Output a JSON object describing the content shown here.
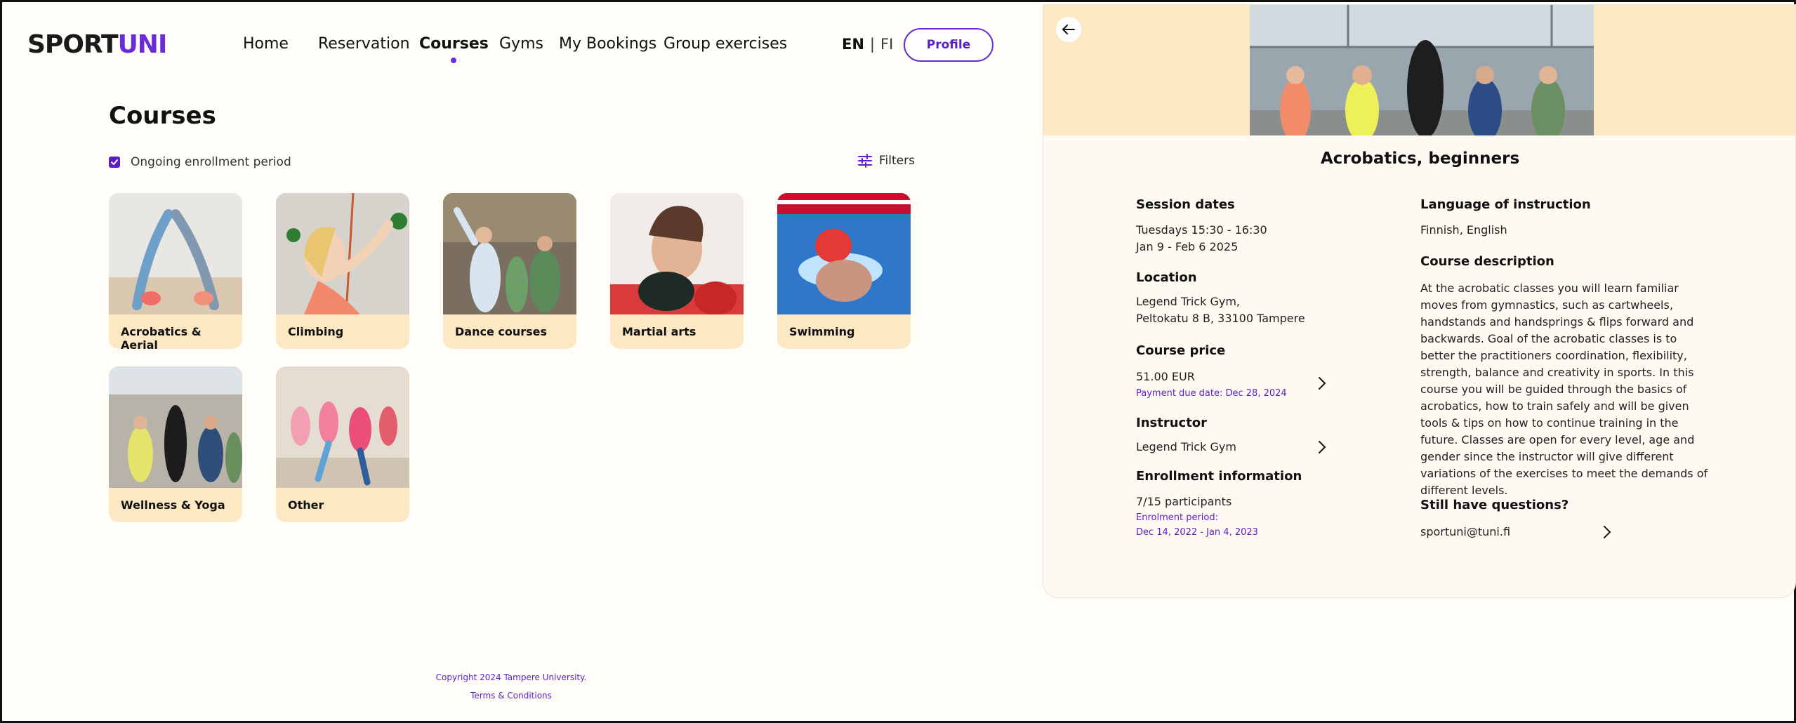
{
  "logo": {
    "sport": "SPORT",
    "uni": "UNI"
  },
  "nav": {
    "home": "Home",
    "reservation": "Reservation",
    "courses": "Courses",
    "gyms": "Gyms",
    "my_bookings": "My Bookings",
    "group_exercises": "Group exercises"
  },
  "lang": {
    "en": "EN",
    "sep": "|",
    "fi": "FI"
  },
  "profile_label": "Profile",
  "page_title": "Courses",
  "enrollment_filter_label": "Ongoing enrollment period",
  "enrollment_filter_checked": true,
  "filters_label": "Filters",
  "categories": [
    {
      "label": "Acrobatics & Aerial"
    },
    {
      "label": "Climbing"
    },
    {
      "label": "Dance courses"
    },
    {
      "label": "Martial arts"
    },
    {
      "label": "Swimming"
    },
    {
      "label": "Wellness & Yoga"
    },
    {
      "label": "Other"
    }
  ],
  "footer": {
    "copyright": "Copyright 2024 Tampere University.",
    "terms": "Terms & Conditions"
  },
  "detail": {
    "title": "Acrobatics, beginners",
    "session_dates": {
      "heading": "Session dates",
      "line1": "Tuesdays 15:30 - 16:30",
      "line2": "Jan 9 - Feb 6 2025"
    },
    "location": {
      "heading": "Location",
      "line1": "Legend Trick Gym,",
      "line2": "Peltokatu 8 B, 33100 Tampere"
    },
    "price": {
      "heading": "Course price",
      "value": "51.00 EUR",
      "due": "Payment due date: Dec 28, 2024"
    },
    "instructor": {
      "heading": "Instructor",
      "name": "Legend Trick Gym"
    },
    "enrollment": {
      "heading": "Enrollment information",
      "participants": "7/15 participants",
      "period_label": "Enrolment period:",
      "period": "Dec 14, 2022 - Jan 4, 2023"
    },
    "language": {
      "heading": "Language of instruction",
      "value": "Finnish, English"
    },
    "description": {
      "heading": "Course description",
      "text": "At the acrobatic classes you will learn familiar moves from gymnastics, such as cartwheels, handstands and handsprings & flips forward and backwards. Goal of the acrobatic classes is to better the practitioners coordination, flexibility, strength, balance and creativity in sports. In this course you will be guided through the basics of acrobatics, how to train safely and will be given tools & tips on how to continue training in the future. Classes are open for every level, age and gender since the instructor will give different variations of the exercises to meet the demands of different levels."
    },
    "questions": {
      "heading": "Still have questions?",
      "email": "sportuni@tuni.fi"
    }
  },
  "colors": {
    "accent": "#6b2bd9",
    "card_bg": "#fde8c4",
    "page_bg": "#fffdf8"
  }
}
